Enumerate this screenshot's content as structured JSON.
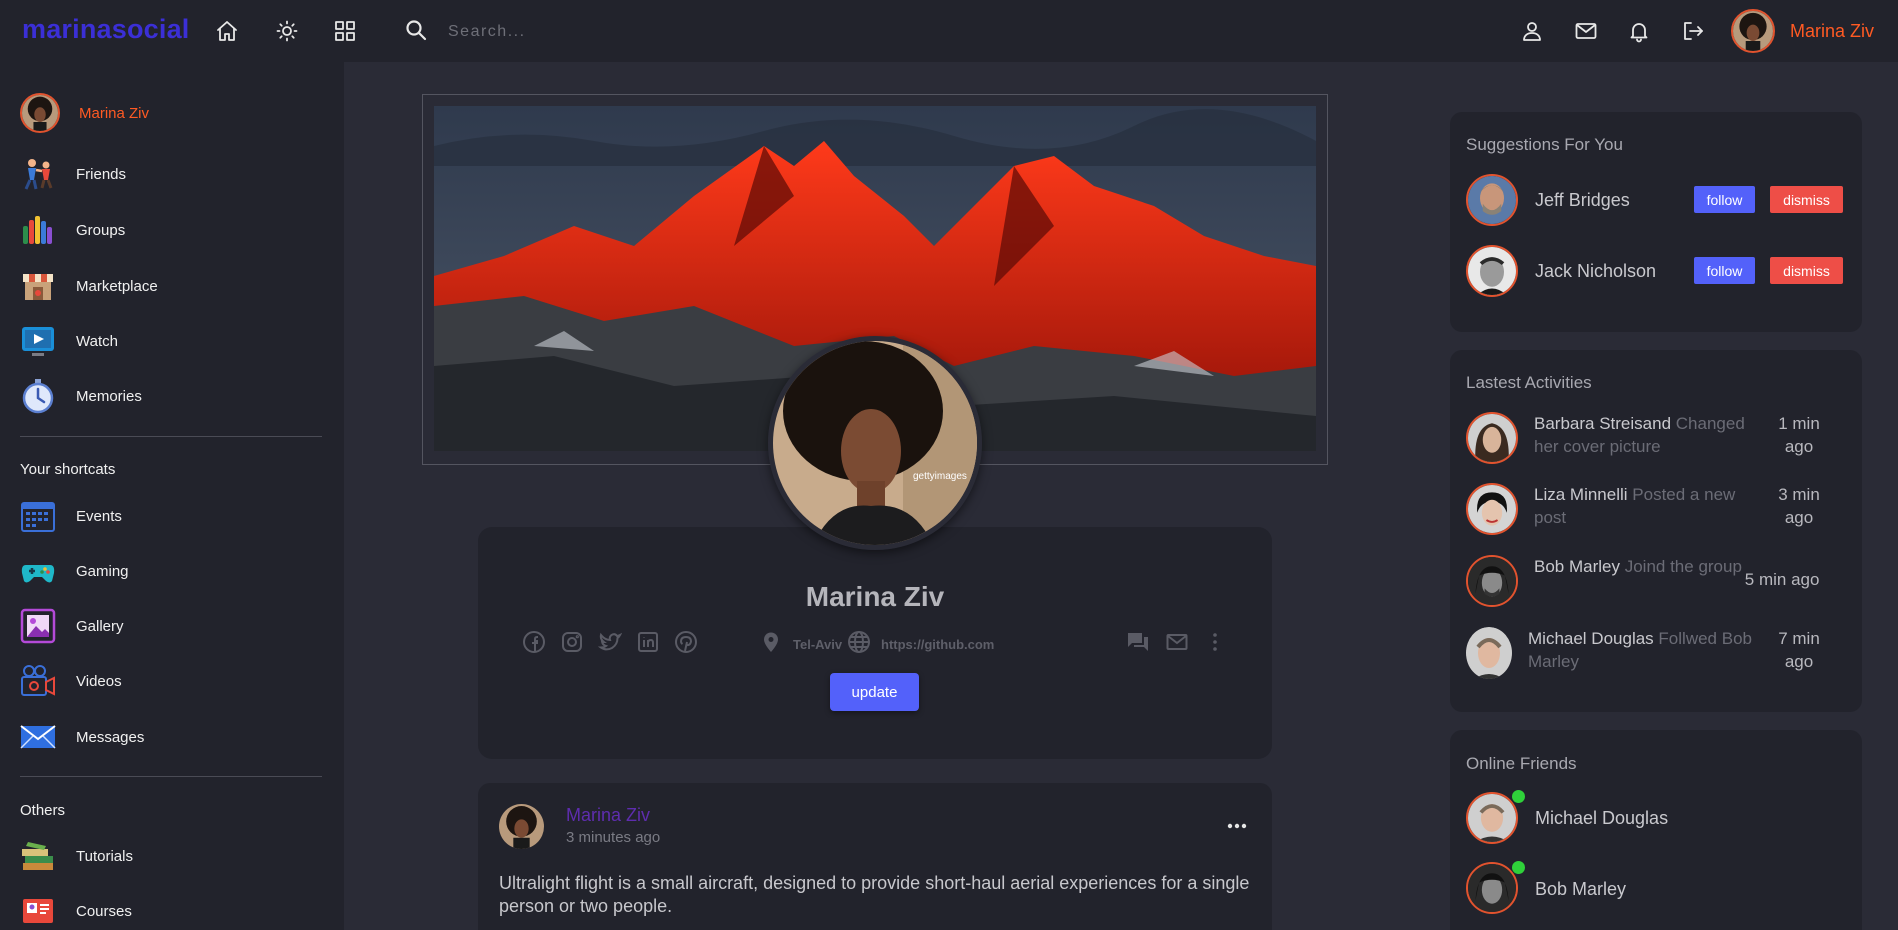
{
  "app": {
    "logo": "marinasocial"
  },
  "navbar": {
    "search_placeholder": "Search...",
    "user_name": "Marina Ziv"
  },
  "sidebar": {
    "profile_name": "Marina Ziv",
    "main_items": [
      {
        "label": "Friends",
        "icon": "friends-icon"
      },
      {
        "label": "Groups",
        "icon": "groups-icon"
      },
      {
        "label": "Marketplace",
        "icon": "marketplace-icon"
      },
      {
        "label": "Watch",
        "icon": "watch-icon"
      },
      {
        "label": "Memories",
        "icon": "memories-icon"
      }
    ],
    "shortcuts_heading": "Your shortcats",
    "shortcuts": [
      {
        "label": "Events",
        "icon": "calendar-icon"
      },
      {
        "label": "Gaming",
        "icon": "gamepad-icon"
      },
      {
        "label": "Gallery",
        "icon": "gallery-icon"
      },
      {
        "label": "Videos",
        "icon": "video-camera-icon"
      },
      {
        "label": "Messages",
        "icon": "envelope-icon"
      }
    ],
    "others_heading": "Others",
    "others": [
      {
        "label": "Tutorials",
        "icon": "books-icon"
      },
      {
        "label": "Courses",
        "icon": "courses-icon"
      }
    ]
  },
  "profile": {
    "name": "Marina Ziv",
    "location": "Tel-Aviv",
    "website": "https://github.com",
    "update_label": "update"
  },
  "post": {
    "author": "Marina Ziv",
    "time": "3 minutes ago",
    "text": "Ultralight flight is a small aircraft, designed to provide short-haul aerial experiences for a single person or two people."
  },
  "suggestions": {
    "title": "Suggestions For You",
    "follow_label": "follow",
    "dismiss_label": "dismiss",
    "people": [
      {
        "name": "Jeff Bridges"
      },
      {
        "name": "Jack Nicholson"
      }
    ]
  },
  "activities": {
    "title": "Lastest Activities",
    "items": [
      {
        "name": "Barbara Streisand",
        "action": "Changed her cover picture",
        "time": "1 min ago"
      },
      {
        "name": "Liza Minnelli",
        "action": "Posted a new post",
        "time": "3 min ago"
      },
      {
        "name": "Bob Marley",
        "action": "Joind the group",
        "time": "5 min ago"
      },
      {
        "name": "Michael Douglas",
        "action": "Follwed Bob Marley",
        "time": "7 min ago"
      }
    ]
  },
  "online": {
    "title": "Online Friends",
    "friends": [
      {
        "name": "Michael Douglas"
      },
      {
        "name": "Bob Marley"
      }
    ]
  },
  "colors": {
    "brand": "#3b2fd6",
    "accent": "#ff5a23",
    "primary_button": "#5361fa",
    "danger_button": "#ee4e47",
    "online": "#2fd13a"
  }
}
